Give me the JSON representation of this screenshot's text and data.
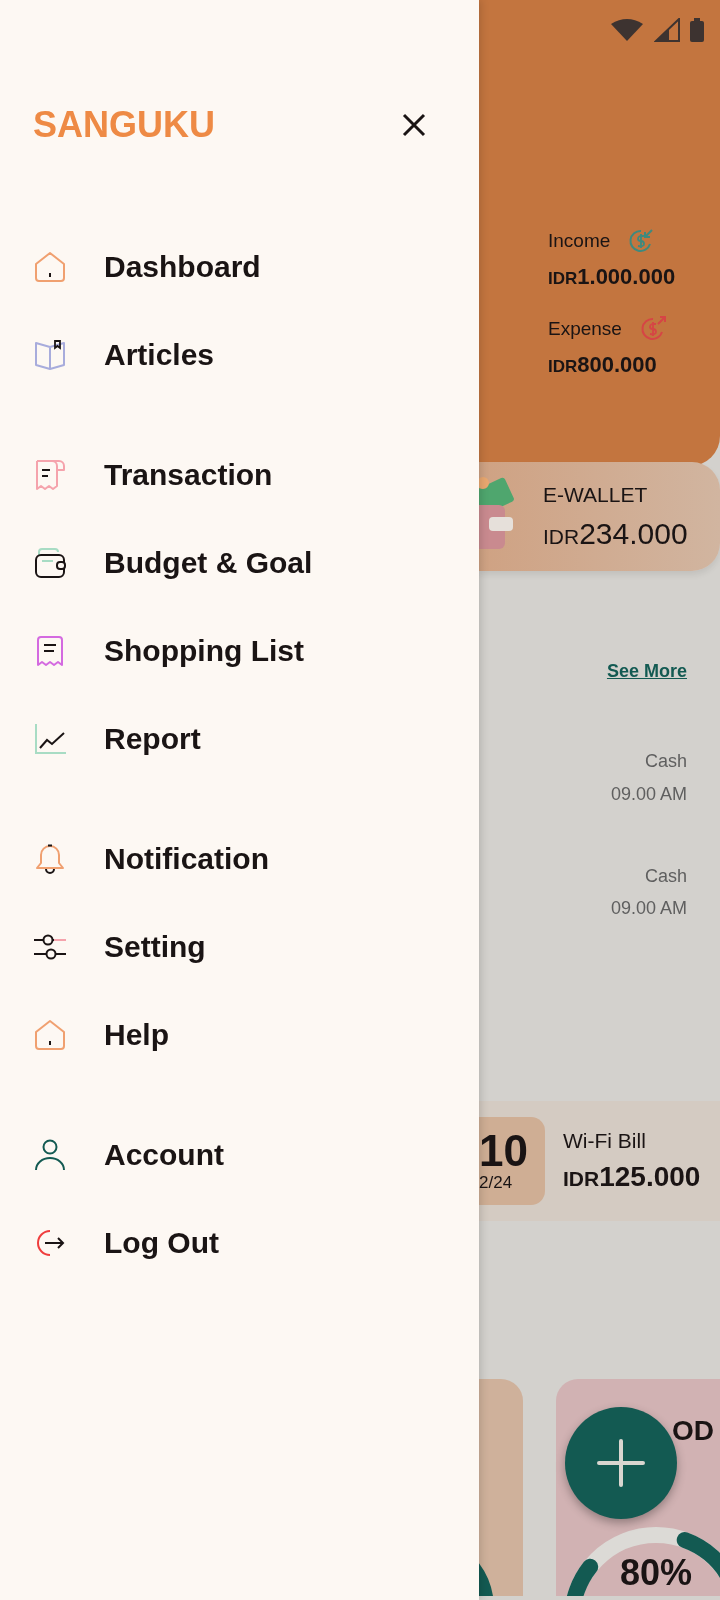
{
  "drawer": {
    "title": "SANGUKU",
    "groups": [
      {
        "items": [
          {
            "label": "Dashboard"
          },
          {
            "label": "Articles"
          }
        ]
      },
      {
        "items": [
          {
            "label": "Transaction"
          },
          {
            "label": "Budget & Goal"
          },
          {
            "label": "Shopping List"
          },
          {
            "label": "Report"
          }
        ]
      },
      {
        "items": [
          {
            "label": "Notification"
          },
          {
            "label": "Setting"
          },
          {
            "label": "Help"
          }
        ]
      },
      {
        "items": [
          {
            "label": "Account"
          },
          {
            "label": "Log Out"
          }
        ]
      }
    ]
  },
  "summary": [
    {
      "kind": "income",
      "label": "Income",
      "currency": "IDR",
      "amount": "1.000.000"
    },
    {
      "kind": "expense",
      "label": "Expense",
      "currency": "IDR",
      "amount": "800.000"
    }
  ],
  "wallet_card": {
    "label": "E-WALLET",
    "currency": "IDR",
    "amount": "234.000"
  },
  "transactions": {
    "link": "See More",
    "rows": [
      {
        "method": "Cash",
        "time": "09.00 AM"
      },
      {
        "method": "Cash",
        "time": "09.00 AM"
      }
    ]
  },
  "bill": {
    "day": "10",
    "date": "2/24",
    "name": "Wi-Fi Bill",
    "currency": "IDR",
    "amount": "125.000"
  },
  "budget_card": {
    "label": "OD",
    "percent": "80%"
  }
}
